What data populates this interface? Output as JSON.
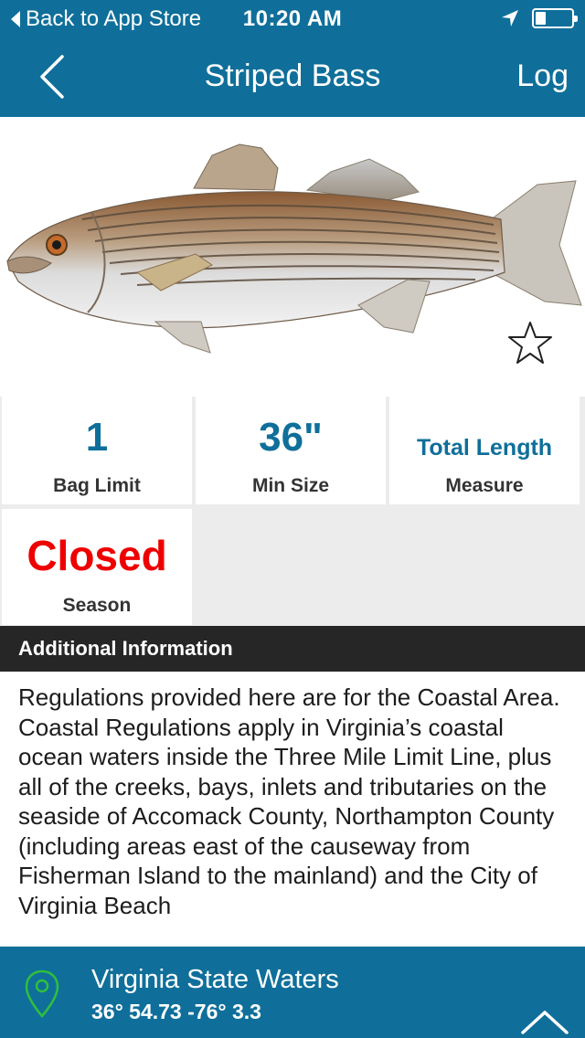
{
  "status_bar": {
    "back_label": "Back to App Store",
    "time": "10:20 AM",
    "battery_level": 0.3
  },
  "nav": {
    "title": "Striped Bass",
    "log_label": "Log"
  },
  "stats": [
    {
      "value": "1",
      "label": "Bag Limit"
    },
    {
      "value": "36\"",
      "label": "Min Size"
    },
    {
      "value": "Total Length",
      "label": "Measure"
    },
    {
      "value": "Closed",
      "label": "Season"
    }
  ],
  "colors": {
    "brand": "#0f6f9a",
    "closed": "#ee0000",
    "header_dark": "#262626",
    "pin": "#2fbf3c"
  },
  "additional_info": {
    "heading": "Additional Information",
    "paragraphs": [
      "Regulations provided here are for the Coastal Area.",
      "Coastal Regulations apply in Virginia’s coastal ocean waters inside the Three Mile Limit Line, plus all of the creeks, bays, inlets and tributaries on the seaside of Accomack County, Northampton County (including areas east of the causeway from Fisherman Island to the mainland) and the City of Virginia Beach"
    ]
  },
  "footer": {
    "location_name": "Virginia State Waters",
    "coordinates": "36° 54.73  -76° 3.3"
  }
}
